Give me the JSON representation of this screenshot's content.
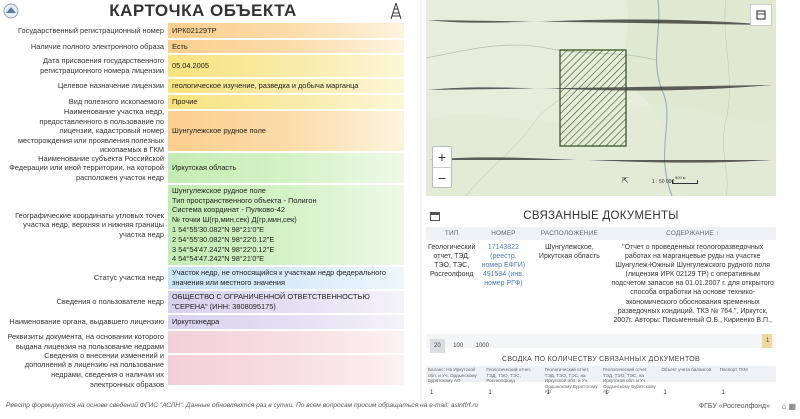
{
  "card": {
    "title": "КАРТОЧКА ОБЪЕКТА",
    "rows": [
      {
        "label": "Государственный регистрационный номер",
        "values": [
          "ИРК02129ТР"
        ],
        "style": "grad-orange",
        "h": 17
      },
      {
        "label": "Наличие полного электронного образа",
        "values": [
          "Есть"
        ],
        "style": "grad-orange",
        "h": 15
      },
      {
        "label": "Дата присвоения государственного регистрационного номера лицензии",
        "values": [
          "05.04.2005"
        ],
        "style": "grad-yellow",
        "h": 24
      },
      {
        "label": "Целевое назначение лицензии",
        "values": [
          "геологическое изучение, разведка и добыча марганца"
        ],
        "style": "grad-yellow",
        "h": 16
      },
      {
        "label": "Вид полезного ископаемого",
        "values": [
          "Прочие"
        ],
        "style": "grad-yellow",
        "h": 16
      },
      {
        "label": "Наименование участка недр, предоставленного в пользование по лицензии, кадастровый номер месторождения или проявления полезных ископаемых в ГКМ",
        "values": [
          "Шунгулежское рудное поле"
        ],
        "style": "grad-orange",
        "h": 42
      },
      {
        "label": "Наименование субъекта Российской Федерации или иной территории, на которой расположен участок недр",
        "values": [
          "Иркутская область"
        ],
        "style": "grad-green",
        "h": 32
      },
      {
        "label": "Географические координаты угловых точек участка недр, верхняя и нижняя границы участка недр",
        "values": [
          "Шунгулежское рудное поле",
          "Тип пространственного объекта - Полигон",
          "Система координат - Пулково-42",
          "№ точки Ш(гр,мин,сек) Д(гр,мин,сек)",
          "1 54°55'30.082\"N 98°21'0\"E",
          "2 54°55'30.082\"N 98°22'0.12\"E",
          "3 54°54'47.242\"N 98°22'0.12\"E",
          "4 54°54'47.242\"N 98°21'0\"E"
        ],
        "style": "grad-green",
        "h": 82
      },
      {
        "label": "Статус участка недр",
        "values": [
          "Участок недр, не относящийся к участкам недр федерального значения или местного значения"
        ],
        "style": "grad-blue",
        "h": 24
      },
      {
        "label": "Сведения о пользователе недр",
        "values": [
          "ОБЩЕСТВО С ОГРАНИЧЕННОЙ ОТВЕТСТВЕННОСТЬЮ \"СЕРЕНА\" (ИНН: 3808095175)"
        ],
        "style": "grad-purple",
        "h": 24
      },
      {
        "label": "Наименование органа, выдавшего лицензию",
        "values": [
          "Иркутскнедра"
        ],
        "style": "grad-purple",
        "h": 16
      },
      {
        "label": "Реквизиты документа, на основании которого выдана лицензия на пользование недрами",
        "values": [
          ""
        ],
        "style": "grad-pink",
        "h": 24
      },
      {
        "label": "Сведения о внесении изменений и дополнений в лицензию на пользование недрами, сведения о наличии их электронных образов",
        "values": [
          ""
        ],
        "style": "grad-pink",
        "h": 32
      }
    ]
  },
  "footer": {
    "note": "Реестр формируется на основе сведений ФГИС \"АСЛН\". Данные обновляются раз в сутки. По всем вопросам просим обращаться на e-mail: aslnffrf.ru",
    "brand": "ФГБУ «Росгеолфонд»"
  },
  "map": {
    "scale_label": "1 : 50 000",
    "scale_bar": "500 м"
  },
  "docs": {
    "title": "СВЯЗАННЫЕ ДОКУМЕНТЫ",
    "columns": [
      "ТИП",
      "НОМЕР",
      "РАСПОЛОЖЕНИЕ",
      "СОДЕРЖАНИЕ ↑"
    ],
    "row": {
      "type": "Геологический отчет, ТЭД, ТЭО, ТЭС, Росгеолфонд",
      "number_link": "17143822",
      "number_note": "(реестр. номер ЕФГИ) 491584 (инв. номер РГФ)",
      "location": "Шунгулежское, Иркутская область",
      "content": "\"Отчет о проведенных геологоразведочных работах на марганцевые руды на участке Шунгулеж-Южный Шунгулежского рудного поля (лицензия ИРК 02129 ТР) с оперативным подсчетом запасов на 01.01.2007 г. для открытого способа отработки на основе технико-экономического обоснования временных разведочных кондиций. ТКЗ № 764.\", Иркутск, 2007г. Авторы: Письменный О.Б., Кириенко В.П.,"
    },
    "page_sizes": [
      "20",
      "100",
      "1000"
    ],
    "current_page": "1"
  },
  "summary": {
    "title": "СВОДКА ПО КОЛИЧЕСТВУ СВЯЗАННЫХ ДОКУМЕНТОВ",
    "columns": [
      "Баланс: На Иркутской обл. и Уч. Ордынскому Бурятскому АО",
      "Геологический отчет, ТЭД, ТЭО, ТЭС, Росгеолфонд",
      "Геологический отчет, ТЭД, ТЭО, ТЭС, на Иркутской обл. и Уч. Ордынскому Бурятскому АО",
      "Геологический отчет, ТЭД, ТЭО, ТЭС, на Иркутской обл. и Уч. Ордынскому Бурятскому АО",
      "Объект учета балансов",
      "Паспорт ГКМ"
    ],
    "values": [
      "1",
      "1",
      "1",
      "1",
      "1",
      "1"
    ]
  }
}
